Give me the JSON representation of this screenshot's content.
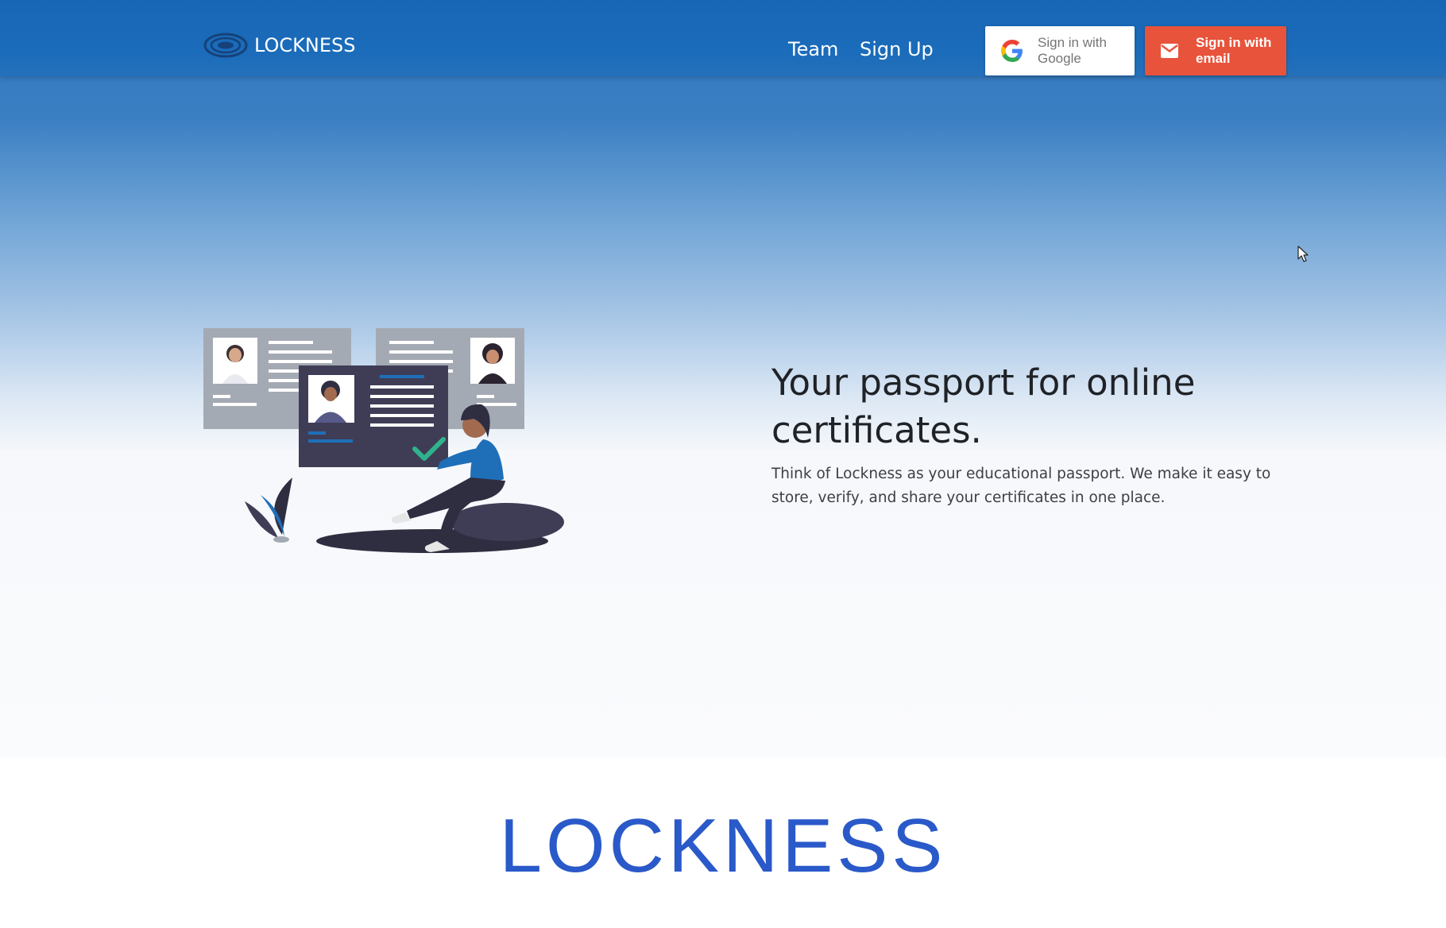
{
  "navbar": {
    "brand": "LOCKNESS",
    "links": [
      {
        "label": "Team"
      },
      {
        "label": "Sign Up"
      }
    ],
    "google_button": {
      "label": "Sign in with Google",
      "icon": "google-icon"
    },
    "email_button": {
      "label": "Sign in with email",
      "icon": "mail-icon"
    }
  },
  "hero": {
    "title": "Your passport for online certificates.",
    "description": "Think of Lockness as your educational passport. We make it easy to store, verify, and share your certificates in one place.",
    "illustration": "person-reviewing-certificates-illustration"
  },
  "footer": {
    "brand": "LOCKNESS"
  },
  "colors": {
    "navbar": "#1a6ab9",
    "google_button": "#ffffff",
    "email_button": "#e8533b",
    "footer_brand": "#2a59c9",
    "headline": "#1f2226"
  }
}
